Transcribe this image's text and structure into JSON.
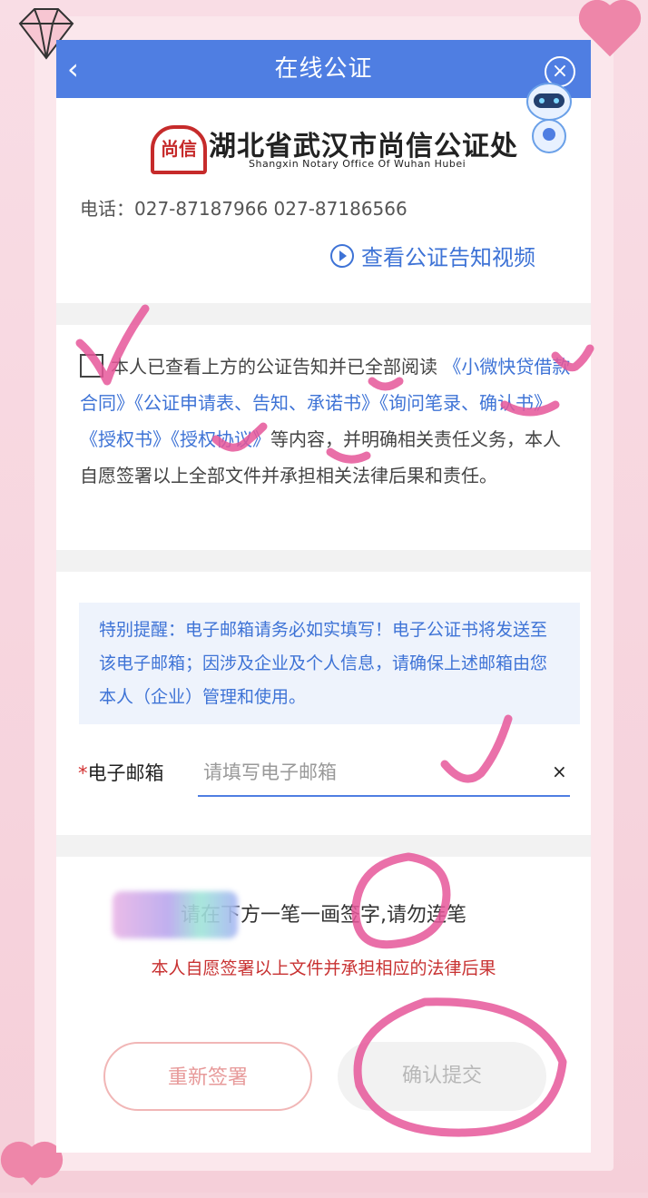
{
  "header": {
    "title": "在线公证",
    "back_icon": "‹",
    "close_icon": "×"
  },
  "logo": {
    "mark_text": "尚信",
    "name_cn": "湖北省武汉市尚信公证处",
    "name_en": "Shangxin Notary Office Of Wuhan Hubei"
  },
  "contact": {
    "phone_line": "电话：027-87187966 027-87186566"
  },
  "video_link": {
    "label": "查看公证告知视频"
  },
  "agreement": {
    "text_before": "本人已查看上方的公证告知并已全部阅读",
    "docs": [
      "《小微快贷借款合同》",
      "《公证申请表、告知、承诺书》",
      "《询问笔录、确认书》",
      "《授权书》",
      "《授权协议》"
    ],
    "text_after": "等内容，并明确相关责任义务，本人自愿签署以上全部文件并承担相关法律后果和责任。"
  },
  "notice": {
    "text": "特别提醒：电子邮箱请务必如实填写！电子公证书将发送至该电子邮箱；因涉及企业及个人信息，请确保上述邮箱由您本人（企业）管理和使用。"
  },
  "email": {
    "required_mark": "*",
    "label": "电子邮箱",
    "placeholder": "请填写电子邮箱",
    "value": "",
    "clear_icon": "×"
  },
  "signature": {
    "hint": "请在下方一笔一画签字,请勿连笔",
    "warning": "本人自愿签署以上文件并承担相应的法律后果",
    "reset_label": "重新签署",
    "submit_label": "确认提交"
  },
  "colors": {
    "primary": "#4f7ee2",
    "link": "#3e73d6",
    "warning": "#c83232",
    "frame_pink": "#f6d3dc",
    "annotation": "#e6579a"
  }
}
